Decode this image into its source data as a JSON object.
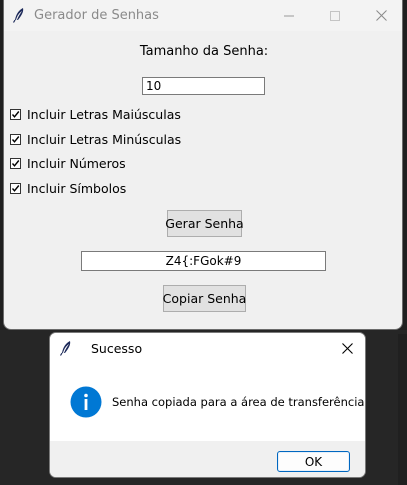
{
  "main_window": {
    "title": "Gerador de Senhas",
    "size_label": "Tamanho da Senha:",
    "size_value": "10",
    "options": [
      {
        "label": "Incluir Letras Maiúsculas",
        "checked": true
      },
      {
        "label": "Incluir Letras Minúsculas",
        "checked": true
      },
      {
        "label": "Incluir Números",
        "checked": true
      },
      {
        "label": "Incluir Símbolos",
        "checked": true
      }
    ],
    "generate_button": "Gerar Senha",
    "generated_password": "Z4{:FGok#9",
    "copy_button": "Copiar Senha"
  },
  "dialog": {
    "title": "Sucesso",
    "message": "Senha copiada para a área de transferência.",
    "ok_button": "OK",
    "icon": "info-icon"
  },
  "colors": {
    "accent": "#0067c0",
    "info_icon": "#0078d4",
    "window_bg": "#f0f0f0",
    "desktop_bg": "#1f1f1f"
  }
}
